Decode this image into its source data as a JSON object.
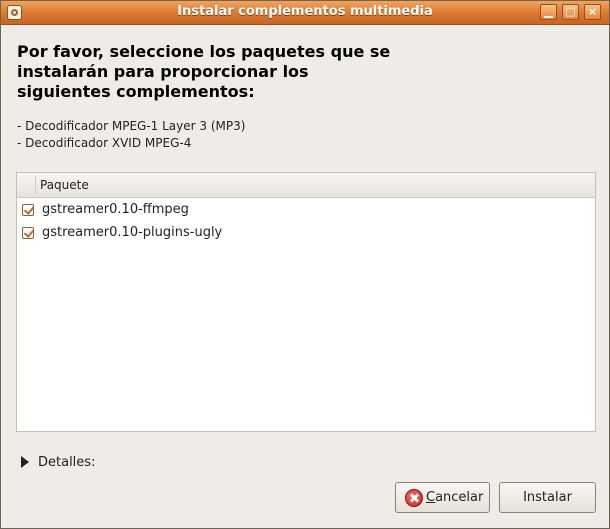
{
  "window": {
    "title": "Instalar complementos multimedia"
  },
  "heading": [
    "Por favor, seleccione los paquetes que se",
    "instalarán para proporcionar los",
    "siguientes complementos:"
  ],
  "plugins": [
    "- Decodificador MPEG-1 Layer 3 (MP3)",
    "- Decodificador XVID MPEG-4"
  ],
  "table": {
    "column": "Paquete",
    "rows": [
      {
        "label": "gstreamer0.10-ffmpeg",
        "checked": true
      },
      {
        "label": "gstreamer0.10-plugins-ugly",
        "checked": true
      }
    ]
  },
  "details": {
    "label": "Detalles:"
  },
  "buttons": {
    "cancel_mnemonic": "C",
    "cancel_rest": "ancelar",
    "install": "Instalar"
  },
  "icons": {
    "app": "app-icon",
    "minimize": "minimize-icon",
    "maximize": "maximize-icon",
    "close": "close-icon",
    "expander": "expander-arrow-icon",
    "cancel": "cancel-icon"
  },
  "colors": {
    "titlebar": "#d9762f",
    "checkmark": "#c5661f",
    "cancel_icon": "#c8261a"
  }
}
